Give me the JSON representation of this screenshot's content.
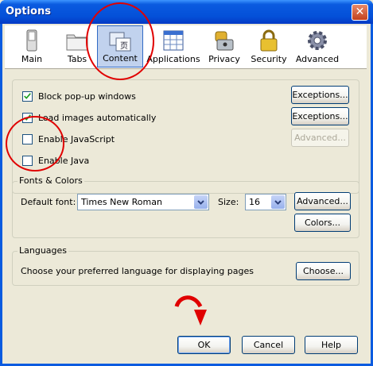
{
  "window": {
    "title": "Options"
  },
  "toolbar": {
    "panes": [
      {
        "label": "Main",
        "icon": "switch-icon"
      },
      {
        "label": "Tabs",
        "icon": "folder-tabs-icon"
      },
      {
        "label": "Content",
        "icon": "content-document-icon",
        "selected": true
      },
      {
        "label": "Applications",
        "icon": "applications-grid-icon"
      },
      {
        "label": "Privacy",
        "icon": "key-icon"
      },
      {
        "label": "Security",
        "icon": "padlock-icon"
      },
      {
        "label": "Advanced",
        "icon": "gear-icon"
      }
    ]
  },
  "content": {
    "block_popups": {
      "label": "Block pop-up windows",
      "checked": true,
      "button": "Exceptions..."
    },
    "load_images": {
      "label": "Load images automatically",
      "checked": true,
      "button": "Exceptions..."
    },
    "enable_javascript": {
      "label": "Enable JavaScript",
      "checked": false,
      "button": "Advanced..."
    },
    "enable_java": {
      "label": "Enable Java",
      "checked": false
    }
  },
  "fonts": {
    "legend": "Fonts & Colors",
    "default_font_label": "Default font:",
    "default_font_value": "Times New Roman",
    "size_label": "Size:",
    "size_value": "16",
    "advanced_button": "Advanced...",
    "colors_button": "Colors..."
  },
  "languages": {
    "legend": "Languages",
    "description": "Choose your preferred language for displaying pages",
    "choose_button": "Choose..."
  },
  "footer": {
    "ok": "OK",
    "cancel": "Cancel",
    "help": "Help"
  },
  "colors": {
    "titlebar": "#0a5be0",
    "selected_pane": "#c1d2ee",
    "annotation": "#e00000"
  }
}
